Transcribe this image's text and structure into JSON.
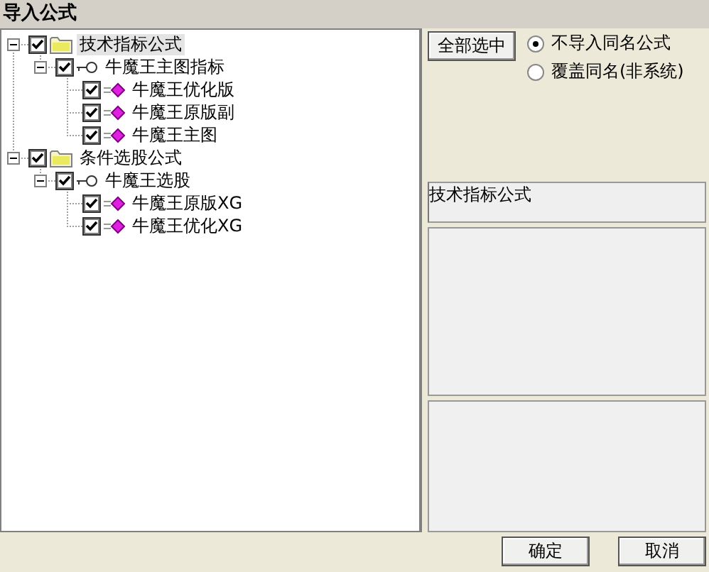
{
  "window": {
    "title": "导入公式"
  },
  "tree": [
    {
      "label": "技术指标公式",
      "kind": "folder",
      "checked": true,
      "expanded": true,
      "selected": true,
      "children": [
        {
          "label": "牛魔王主图指标",
          "kind": "key",
          "checked": true,
          "expanded": true,
          "selected": false,
          "children": [
            {
              "label": "牛魔王优化版",
              "kind": "formula",
              "checked": true,
              "selected": false
            },
            {
              "label": "牛魔王原版副",
              "kind": "formula",
              "checked": true,
              "selected": false
            },
            {
              "label": "牛魔王主图",
              "kind": "formula",
              "checked": true,
              "selected": false
            }
          ]
        }
      ]
    },
    {
      "label": "条件选股公式",
      "kind": "folder",
      "checked": true,
      "expanded": true,
      "selected": false,
      "children": [
        {
          "label": "牛魔王选股",
          "kind": "key",
          "checked": true,
          "expanded": true,
          "selected": false,
          "children": [
            {
              "label": "牛魔王原版XG",
              "kind": "formula",
              "checked": true,
              "selected": false
            },
            {
              "label": "牛魔王优化XG",
              "kind": "formula",
              "checked": true,
              "selected": false
            }
          ]
        }
      ]
    }
  ],
  "select_all_button": "全部选中",
  "options": [
    {
      "label": "不导入同名公式",
      "selected": true
    },
    {
      "label": "覆盖同名(非系统)",
      "selected": false
    }
  ],
  "info_field": {
    "value": "技术指标公式"
  },
  "buttons": [
    "确定",
    "取消"
  ]
}
